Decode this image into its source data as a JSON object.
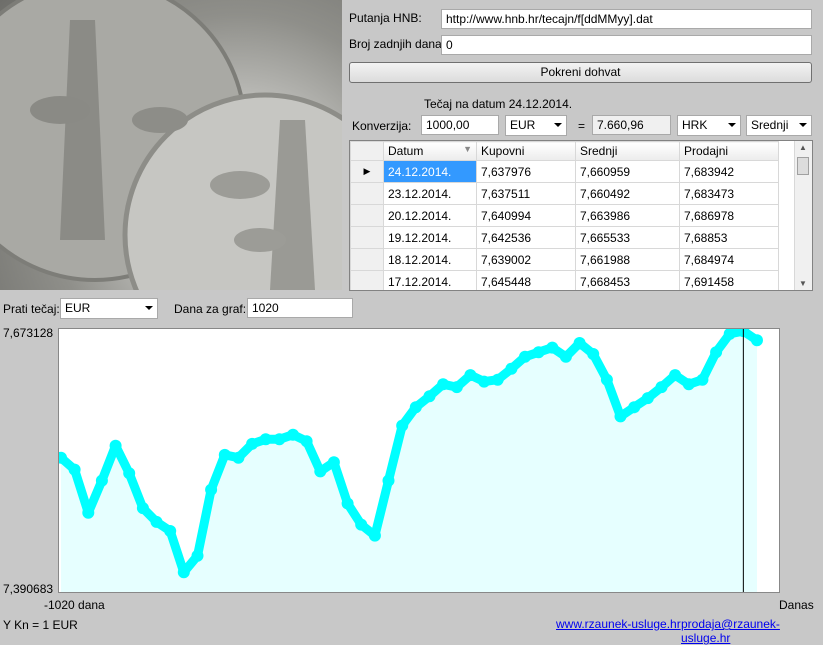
{
  "config": {
    "path_label": "Putanja HNB:",
    "path_value": "http://www.hnb.hr/tecajn/f[ddMMyy].dat",
    "days_label": "Broj zadnjih dana:",
    "days_value": "0",
    "fetch_button": "Pokreni dohvat"
  },
  "conversion": {
    "rate_date_text": "Tečaj na datum 24.12.2014.",
    "label": "Konverzija:",
    "amount": "1000,00",
    "from_currency": "EUR",
    "equals": "=",
    "result": "7.660,96",
    "to_currency": "HRK",
    "rate_type": "Srednji"
  },
  "table": {
    "columns": [
      "Datum",
      "Kupovni",
      "Srednji",
      "Prodajni"
    ],
    "rows": [
      [
        "24.12.2014.",
        "7,637976",
        "7,660959",
        "7,683942"
      ],
      [
        "23.12.2014.",
        "7,637511",
        "7,660492",
        "7,683473"
      ],
      [
        "20.12.2014.",
        "7,640994",
        "7,663986",
        "7,686978"
      ],
      [
        "19.12.2014.",
        "7,642536",
        "7,665533",
        "7,68853"
      ],
      [
        "18.12.2014.",
        "7,639002",
        "7,661988",
        "7,684974"
      ],
      [
        "17.12.2014.",
        "7,645448",
        "7,668453",
        "7,691458"
      ]
    ]
  },
  "graph_controls": {
    "track_label": "Prati tečaj:",
    "track_currency": "EUR",
    "days_label": "Dana za graf:",
    "days_value": "1020"
  },
  "chart_data": {
    "type": "area",
    "y_max_label": "7,673128",
    "y_min_label": "7,390683",
    "ylim": [
      7.390683,
      7.673128
    ],
    "x_start_label": "-1020 dana",
    "x_end_label": "Danas",
    "x_range": [
      -1020,
      0
    ],
    "series": [
      {
        "color": "#00ffff",
        "fill": "#e6ffff",
        "x": [
          -1020,
          -1000,
          -980,
          -960,
          -940,
          -920,
          -900,
          -880,
          -860,
          -840,
          -820,
          -800,
          -780,
          -760,
          -740,
          -720,
          -700,
          -680,
          -660,
          -640,
          -620,
          -600,
          -580,
          -560,
          -540,
          -520,
          -500,
          -480,
          -460,
          -440,
          -420,
          -400,
          -380,
          -360,
          -340,
          -320,
          -300,
          -280,
          -260,
          -240,
          -220,
          -200,
          -180,
          -160,
          -140,
          -120,
          -100,
          -80,
          -60,
          -40,
          -20,
          0
        ],
        "values": [
          7.535,
          7.522,
          7.475,
          7.51,
          7.548,
          7.518,
          7.48,
          7.465,
          7.455,
          7.41,
          7.428,
          7.5,
          7.538,
          7.535,
          7.55,
          7.555,
          7.555,
          7.56,
          7.553,
          7.52,
          7.53,
          7.485,
          7.462,
          7.45,
          7.51,
          7.57,
          7.59,
          7.602,
          7.615,
          7.612,
          7.625,
          7.618,
          7.62,
          7.632,
          7.645,
          7.65,
          7.655,
          7.645,
          7.66,
          7.648,
          7.62,
          7.58,
          7.59,
          7.6,
          7.612,
          7.625,
          7.615,
          7.62,
          7.65,
          7.67,
          7.673,
          7.663
        ]
      }
    ],
    "marker_x": -20
  },
  "footer": {
    "unit_note": "Y Kn = 1 EUR",
    "link_web": "www.rzaunek-usluge.hr",
    "link_email": "prodaja@rzaunek-usluge.hr"
  }
}
